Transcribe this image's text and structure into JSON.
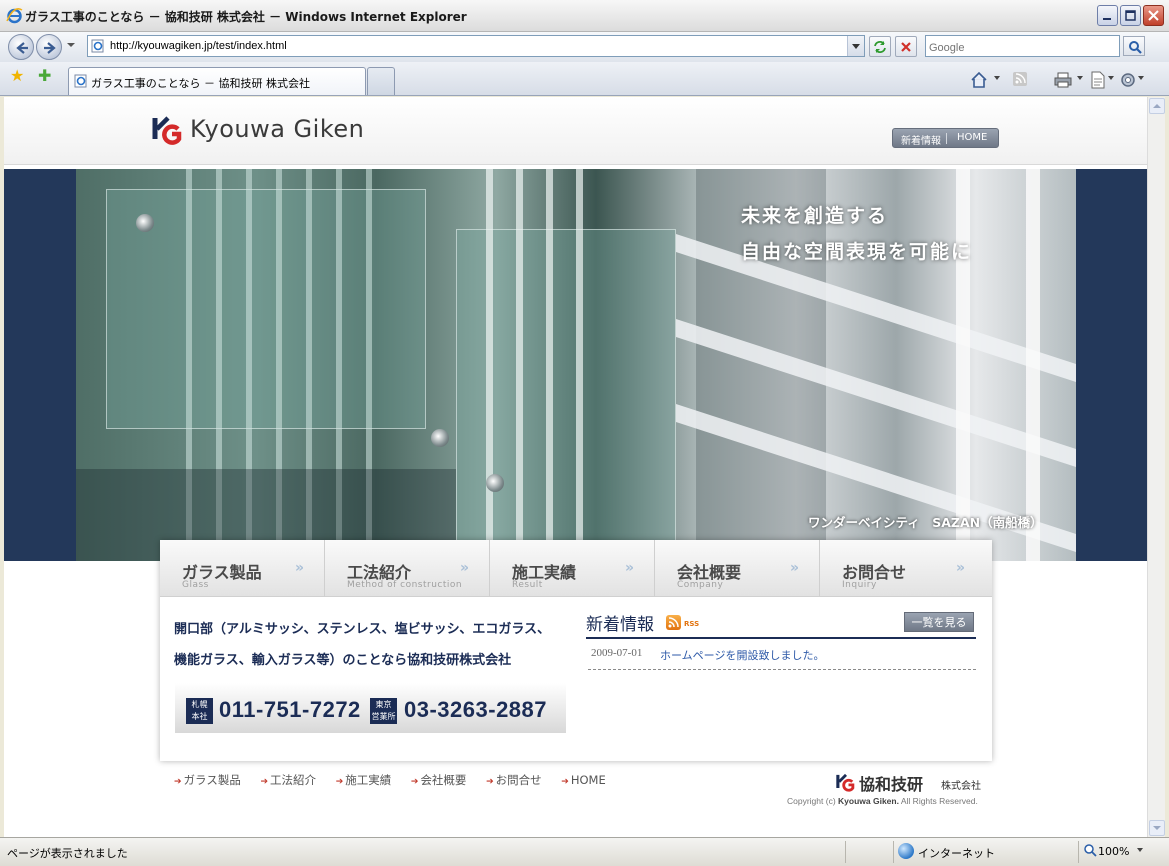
{
  "window": {
    "title": "ガラス工事のことなら － 協和技研 株式会社 － Windows Internet Explorer"
  },
  "browser": {
    "url": "http://kyouwagiken.jp/test/index.html",
    "search_placeholder": "Google",
    "tab_title": "ガラス工事のことなら － 協和技研 株式会社",
    "status_text": "ページが表示されました",
    "zone_text": "インターネット",
    "zoom_text": "100%"
  },
  "site": {
    "logo_text": "Kyouwa Giken",
    "header_links": [
      "新着情報",
      "HOME"
    ],
    "hero": {
      "tagline_1": "未来を創造する",
      "tagline_2": "自由な空間表現を可能に",
      "caption": "ワンダーベイシティ　SAZAN（南船橋）"
    },
    "nav": [
      {
        "jp": "ガラス製品",
        "en": "Glass"
      },
      {
        "jp": "工法紹介",
        "en": "Method of construction"
      },
      {
        "jp": "施工実績",
        "en": "Result"
      },
      {
        "jp": "会社概要",
        "en": "Company"
      },
      {
        "jp": "お問合せ",
        "en": "Inquiry"
      }
    ],
    "intro_line_1": "開口部（アルミサッシ、ステンレス、塩ビサッシ、エコガラス、",
    "intro_line_2": "機能ガラス、輸入ガラス等）のことなら協和技研株式会社",
    "phones": [
      {
        "badge_1": "札幌",
        "badge_2": "本社",
        "number": "011-751-7272"
      },
      {
        "badge_1": "東京",
        "badge_2": "営業所",
        "number": "03-3263-2887"
      }
    ],
    "news": {
      "title": "新着情報",
      "rss_label": "RSS",
      "more_label": "一覧を見る",
      "items": [
        {
          "date": "2009-07-01",
          "text": "ホームページを開設致しました。"
        }
      ]
    },
    "footer": {
      "links": [
        "ガラス製品",
        "工法紹介",
        "施工実績",
        "会社概要",
        "お問合せ",
        "HOME"
      ],
      "company_name": "協和技研",
      "company_suffix": "株式会社",
      "copyright_prefix": "Copyright (c)",
      "copyright_name": "Kyouwa Giken.",
      "copyright_suffix": "All Rights Reserved."
    }
  },
  "colors": {
    "brand_navy": "#1b2c55",
    "hero_band": "#23385a",
    "logo_red": "#d42a2a"
  }
}
